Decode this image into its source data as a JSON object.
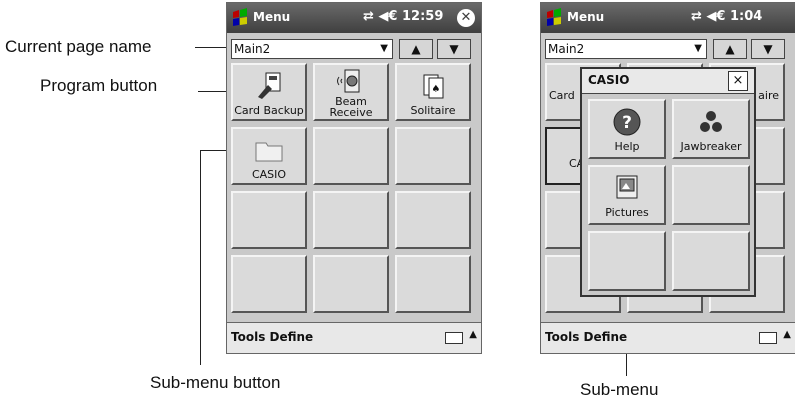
{
  "callouts": {
    "current_page_name": "Current page name",
    "program_button": "Program button",
    "submenu_button": "Sub-menu button",
    "submenu": "Sub-menu"
  },
  "left": {
    "title": "Menu",
    "status": "⇄ ◀€ 12:59",
    "page_name": "Main2",
    "tiles": [
      "Card Backup",
      "Beam Receive",
      "Solitaire",
      "CASIO",
      "",
      "",
      "",
      "",
      "",
      "",
      "",
      ""
    ],
    "bottom_bar": "Tools  Define"
  },
  "right": {
    "title": "Menu",
    "status": "⇄ ◀€ 1:04",
    "page_name": "Main2",
    "bg_tile_fragments": [
      "Card",
      "aire",
      "CA"
    ],
    "bottom_bar": "Tools  Define",
    "popup": {
      "title": "CASIO",
      "close": "×",
      "items": [
        "Help",
        "Jawbreaker",
        "Pictures",
        "",
        "",
        ""
      ]
    }
  },
  "icons": [
    "windows-flag-icon",
    "dropdown-arrow-icon",
    "up-arrow-icon",
    "down-arrow-icon",
    "close-icon",
    "keyboard-icon",
    "folder-icon",
    "help-icon",
    "jawbreaker-icon",
    "pictures-icon",
    "solitaire-icon",
    "beam-icon",
    "card-backup-icon"
  ]
}
